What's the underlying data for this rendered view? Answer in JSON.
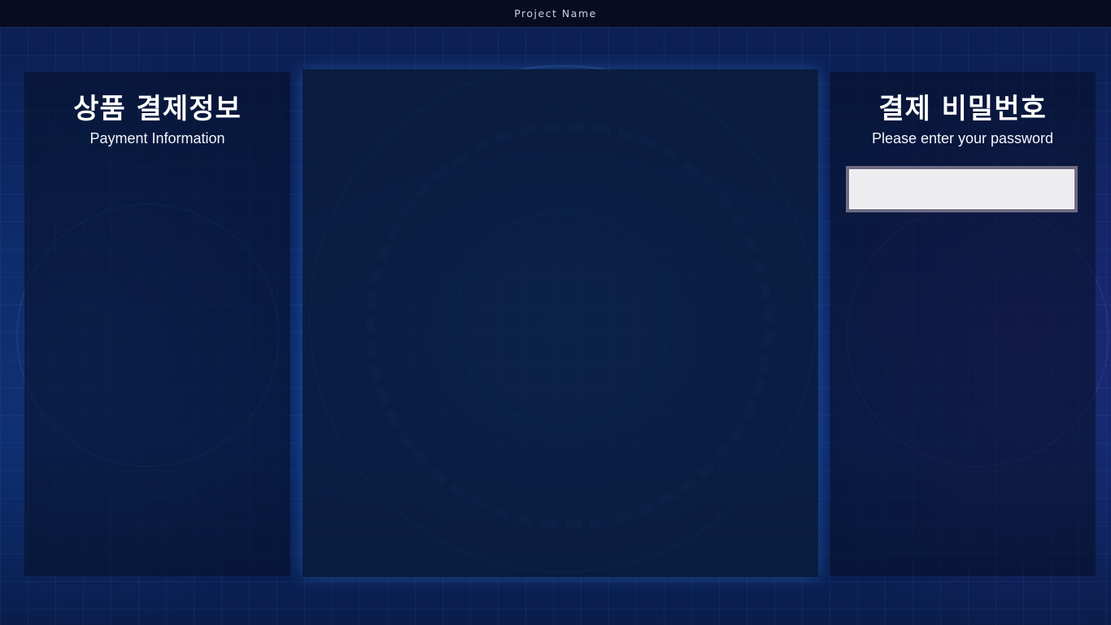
{
  "app": {
    "project_name": "Project Name"
  },
  "payment_info_panel": {
    "title_ko": "상품 결제정보",
    "title_en": "Payment Information"
  },
  "password_panel": {
    "title_ko": "결제 비밀번호",
    "title_en": "Please enter your password",
    "password_value": "",
    "password_placeholder": ""
  },
  "colors": {
    "background": "#0b2563",
    "topbar": "#070c20",
    "center_panel": "#0a1c3a",
    "input_border": "#6e6b85",
    "input_fill": "#ededf0",
    "title_text": "#ffffff"
  }
}
